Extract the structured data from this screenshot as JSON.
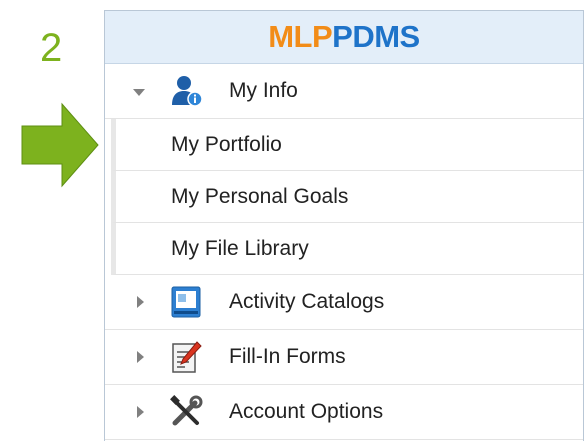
{
  "step": {
    "number": "2"
  },
  "colors": {
    "accent_green": "#7db21e",
    "logo_orange": "#f28c18",
    "logo_blue": "#1e73c9"
  },
  "header": {
    "logo_part1": "MLP",
    "logo_part2": "PDMS"
  },
  "menu": {
    "my_info": {
      "label": "My Info",
      "icon": "user-info-icon",
      "expanded": true,
      "items": [
        {
          "label": "My Portfolio"
        },
        {
          "label": "My Personal Goals"
        },
        {
          "label": "My File Library"
        }
      ]
    },
    "groups": [
      {
        "label": "Activity Catalogs",
        "icon": "catalog-icon",
        "expanded": false
      },
      {
        "label": "Fill-In Forms",
        "icon": "form-edit-icon",
        "expanded": false
      },
      {
        "label": "Account Options",
        "icon": "tools-icon",
        "expanded": false
      }
    ]
  }
}
